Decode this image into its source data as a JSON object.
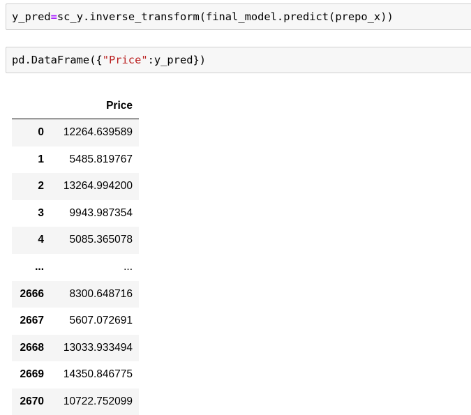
{
  "cells": [
    {
      "parts": [
        {
          "text": "y_pred",
          "kind": "plain"
        },
        {
          "text": "=",
          "kind": "op"
        },
        {
          "text": "sc_y.inverse_transform(final_model.predict(prepo_x))",
          "kind": "plain"
        }
      ]
    },
    {
      "parts": [
        {
          "text": "pd.DataFrame({",
          "kind": "plain"
        },
        {
          "text": "\"Price\"",
          "kind": "str"
        },
        {
          "text": ":y_pred})",
          "kind": "plain"
        }
      ]
    }
  ],
  "dataframe": {
    "column": "Price",
    "rows": [
      {
        "index": "0",
        "value": "12264.639589"
      },
      {
        "index": "1",
        "value": "5485.819767"
      },
      {
        "index": "2",
        "value": "13264.994200"
      },
      {
        "index": "3",
        "value": "9943.987354"
      },
      {
        "index": "4",
        "value": "5085.365078"
      },
      {
        "index": "...",
        "value": "..."
      },
      {
        "index": "2666",
        "value": "8300.648716"
      },
      {
        "index": "2667",
        "value": "5607.072691"
      },
      {
        "index": "2668",
        "value": "13033.933494"
      },
      {
        "index": "2669",
        "value": "14350.846775"
      },
      {
        "index": "2670",
        "value": "10722.752099"
      }
    ]
  }
}
